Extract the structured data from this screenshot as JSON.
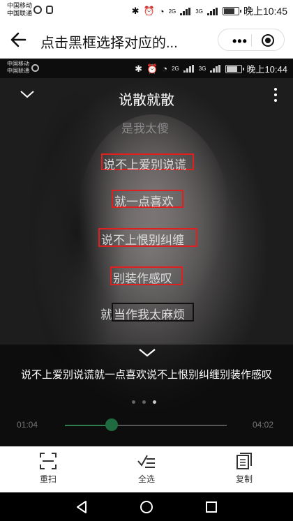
{
  "status_bar": {
    "carrier1": "中国移动",
    "carrier2": "中国联通",
    "net1": "2G",
    "net2": "3G",
    "time": "晚上10:45"
  },
  "nav": {
    "title": "点击黑框选择对应的..."
  },
  "player_status_bar": {
    "carrier1": "中国移动",
    "carrier2": "中国联通",
    "net1": "2G",
    "net2": "3G",
    "time": "晚上10:44"
  },
  "player": {
    "song_title": "说散就散",
    "lyrics": [
      {
        "text": "是我太傻",
        "state": "dim"
      },
      {
        "text": "说不上爱别说谎",
        "state": "selected"
      },
      {
        "text": "就一点喜欢",
        "state": "selected"
      },
      {
        "text": "说不上恨别纠缠",
        "state": "selected"
      },
      {
        "text": "别装作感叹",
        "state": "selected"
      },
      {
        "prefix": "就",
        "text": "当作我太麻烦",
        "state": "unselected"
      }
    ],
    "current_time": "01:04",
    "total_time": "04:02",
    "progress": 0.29,
    "page_index": 3,
    "page_count": 3
  },
  "recognized_text": "说不上爱别说谎就一点喜欢说不上恨别纠缠别装作感叹",
  "actions": [
    {
      "label": "重扫",
      "icon": "rescan-icon"
    },
    {
      "label": "全选",
      "icon": "select-all-icon"
    },
    {
      "label": "复制",
      "icon": "copy-icon"
    }
  ],
  "colors": {
    "selected_box": "#e02020",
    "unselected_box": "#111111",
    "progress": "#2e7d50"
  }
}
